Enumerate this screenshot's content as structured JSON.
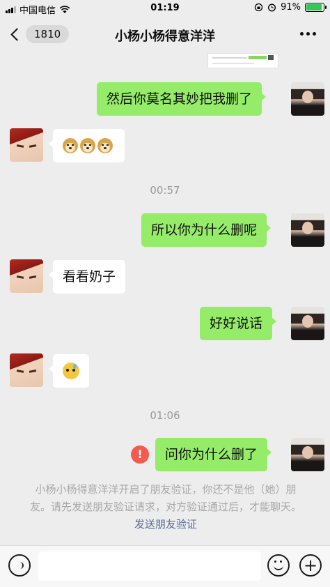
{
  "status_bar": {
    "carrier": "中国电信",
    "time": "01:19",
    "battery_percent": "91%",
    "battery_level": 0.91
  },
  "nav": {
    "back_count": "1810",
    "title": "小杨小杨得意洋洋"
  },
  "messages": [
    {
      "side": "right",
      "text": "然后你莫名其妙把我删了"
    },
    {
      "side": "left",
      "emoji": "doge-x3"
    },
    {
      "timestamp": "00:57"
    },
    {
      "side": "right",
      "text": "所以你为什么删呢"
    },
    {
      "side": "left",
      "text": "看看奶子"
    },
    {
      "side": "right",
      "text": "好好说话"
    },
    {
      "side": "left",
      "emoji": "sweat-emoji"
    },
    {
      "timestamp": "01:06"
    },
    {
      "side": "right",
      "text": "问你为什么删了",
      "failed": true,
      "error_mark": "!"
    }
  ],
  "system_note": {
    "text": "小杨小杨得意洋洋开启了朋友验证，你还不是他（她）朋友。请先发送朋友验证请求，对方验证通过后，才能聊天。",
    "link": "发送朋友验证"
  },
  "input_bar": {
    "plus_symbol": "+"
  },
  "colors": {
    "background": "#ededed",
    "sent_bubble": "#95ec69",
    "received_bubble": "#ffffff",
    "error": "#f25b4e",
    "link": "#576b95"
  }
}
